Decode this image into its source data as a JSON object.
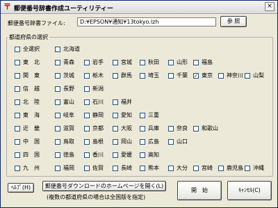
{
  "window": {
    "title": "郵便番号辞書作成ユーティリティー",
    "close_label": "×"
  },
  "file": {
    "label": "郵便番号辞書ファイル:",
    "value": "D:¥EPSON¥通知¥13tokyo.lzh",
    "browse_label": "参 照"
  },
  "prefectures": {
    "group_title": "都道府県の選択",
    "rows": [
      {
        "items": [
          {
            "label": "全選択",
            "checked": false
          },
          {
            "label": "北海道",
            "checked": false
          }
        ]
      },
      {
        "items": [
          {
            "label": "東　北",
            "checked": false
          },
          {
            "label": "青森",
            "checked": false
          },
          {
            "label": "岩手",
            "checked": false
          },
          {
            "label": "宮城",
            "checked": false
          },
          {
            "label": "秋田",
            "checked": false
          },
          {
            "label": "山形",
            "checked": false
          },
          {
            "label": "福島",
            "checked": false
          }
        ]
      },
      {
        "items": [
          {
            "label": "関　東",
            "checked": false
          },
          {
            "label": "茨城",
            "checked": false
          },
          {
            "label": "栃木",
            "checked": false
          },
          {
            "label": "群馬",
            "checked": false
          },
          {
            "label": "埼玉",
            "checked": false
          },
          {
            "label": "千葉",
            "checked": false
          },
          {
            "label": "東京",
            "checked": true
          },
          {
            "label": "神奈川",
            "checked": false
          },
          {
            "label": "山梨",
            "checked": false
          }
        ]
      },
      {
        "items": [
          {
            "label": "信　越",
            "checked": false
          },
          {
            "label": "長野",
            "checked": false
          },
          {
            "label": "新潟",
            "checked": false
          }
        ]
      },
      {
        "items": [
          {
            "label": "北　陸",
            "checked": false
          },
          {
            "label": "富山",
            "checked": false
          },
          {
            "label": "石川",
            "checked": false
          },
          {
            "label": "福井",
            "checked": false
          }
        ]
      },
      {
        "items": [
          {
            "label": "東　海",
            "checked": false
          },
          {
            "label": "岐阜",
            "checked": false
          },
          {
            "label": "静岡",
            "checked": false
          },
          {
            "label": "愛知",
            "checked": false
          },
          {
            "label": "三重",
            "checked": false
          }
        ]
      },
      {
        "items": [
          {
            "label": "近　畿",
            "checked": false
          },
          {
            "label": "滋賀",
            "checked": false
          },
          {
            "label": "京都",
            "checked": false
          },
          {
            "label": "大阪",
            "checked": false
          },
          {
            "label": "兵庫",
            "checked": false
          },
          {
            "label": "奈良",
            "checked": false
          },
          {
            "label": "和歌山",
            "checked": false
          }
        ]
      },
      {
        "items": [
          {
            "label": "中　国",
            "checked": false
          },
          {
            "label": "鳥取",
            "checked": false
          },
          {
            "label": "島根",
            "checked": false
          },
          {
            "label": "岡山",
            "checked": false
          },
          {
            "label": "広島",
            "checked": false
          },
          {
            "label": "山口",
            "checked": false
          }
        ]
      },
      {
        "items": [
          {
            "label": "四　国",
            "checked": false
          },
          {
            "label": "徳島",
            "checked": false
          },
          {
            "label": "香川",
            "checked": false
          },
          {
            "label": "愛媛",
            "checked": false
          },
          {
            "label": "高知",
            "checked": false
          }
        ]
      },
      {
        "items": [
          {
            "label": "九　州",
            "checked": false
          },
          {
            "label": "福岡",
            "checked": false
          },
          {
            "label": "佐賀",
            "checked": false
          },
          {
            "label": "長崎",
            "checked": false
          },
          {
            "label": "熊本",
            "checked": false
          },
          {
            "label": "大分",
            "checked": false
          },
          {
            "label": "宮崎",
            "checked": false
          },
          {
            "label": "鹿児島",
            "checked": false
          },
          {
            "label": "沖縄",
            "checked": false
          }
        ]
      }
    ]
  },
  "buttons": {
    "help_label": "ﾍﾙﾌﾟ(H)",
    "homepage_label": "郵便番号ダウンロードのホームページを開く(L)",
    "start_label": "開　始",
    "cancel_label": "ｷｬﾝｾﾙ(C)"
  },
  "note": "(複数の都道府県の場合は全国版を指定)",
  "colors": {
    "window_bg": "#ece9d8",
    "icon_accent": "#d00000",
    "check_mark": "#000000"
  },
  "icons": {
    "app": "postal-mark-icon",
    "close": "close-icon"
  }
}
